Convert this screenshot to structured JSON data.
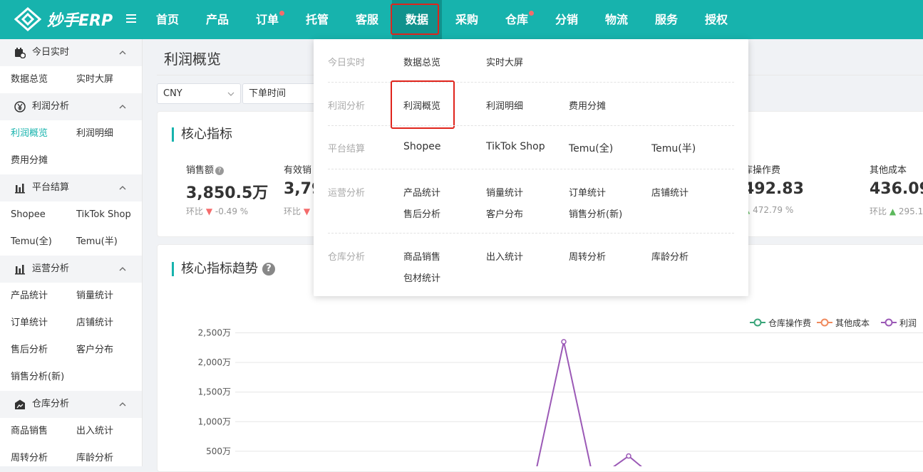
{
  "app": {
    "logo_text": "妙手ERP"
  },
  "topnav": {
    "items": [
      {
        "label": "首页"
      },
      {
        "label": "产品"
      },
      {
        "label": "订单",
        "dot": true
      },
      {
        "label": "托管"
      },
      {
        "label": "客服"
      },
      {
        "label": "数据",
        "active": true
      },
      {
        "label": "采购"
      },
      {
        "label": "仓库",
        "dot": true
      },
      {
        "label": "分销"
      },
      {
        "label": "物流"
      },
      {
        "label": "服务"
      },
      {
        "label": "授权"
      }
    ]
  },
  "sidebar": {
    "groups": [
      {
        "label": "今日实时",
        "icon": "calendar-clock-icon",
        "items": [
          "数据总览",
          "实时大屏"
        ]
      },
      {
        "label": "利润分析",
        "icon": "yen-circle-icon",
        "items": [
          "利润概览",
          "利润明细",
          "费用分摊"
        ]
      },
      {
        "label": "平台结算",
        "icon": "bar-chart-icon",
        "items": [
          "Shopee",
          "TikTok Shop",
          "Temu(全)",
          "Temu(半)"
        ]
      },
      {
        "label": "运营分析",
        "icon": "bar-chart-icon",
        "items": [
          "产品统计",
          "销量统计",
          "订单统计",
          "店铺统计",
          "售后分析",
          "客户分布",
          "销售分析(新)"
        ]
      },
      {
        "label": "仓库分析",
        "icon": "warehouse-icon",
        "items": [
          "商品销售",
          "出入统计",
          "周转分析",
          "库龄分析"
        ]
      }
    ],
    "active_item": "利润概览"
  },
  "page": {
    "title": "利润概览",
    "currency_select": "CNY",
    "time_select": "下单时间"
  },
  "core_metrics": {
    "title": "核心指标",
    "cmp_label": "环比",
    "metrics": [
      {
        "label": "销售额",
        "value": "3,850.5万",
        "change": "-0.49 %",
        "trend": "down"
      },
      {
        "label": "有效销",
        "value": "3,79",
        "trend": "down"
      },
      {
        "label": "库操作费",
        "value": "492.83",
        "change": "472.79 %",
        "trend": "up"
      },
      {
        "label": "其他成本",
        "value": "436.09",
        "change": "295.1",
        "trend": "up"
      }
    ]
  },
  "trend": {
    "title": "核心指标趋势",
    "legend": [
      {
        "name": "仓库操作费",
        "color": "#3aa57a"
      },
      {
        "name": "其他成本",
        "color": "#f08a5d"
      },
      {
        "name": "利润",
        "color": "#9b59b6"
      }
    ]
  },
  "chart_data": {
    "type": "line",
    "title": "核心指标趋势",
    "y_ticks": [
      "2,500万",
      "2,000万",
      "1,500万",
      "1,000万",
      "500万"
    ],
    "ylim": [
      0,
      2500
    ],
    "y_unit": "万",
    "grid": true,
    "legend_position": "top-right",
    "series": [
      {
        "name": "利润",
        "color": "#9b59b6",
        "points": [
          [
            0,
            0
          ],
          [
            1,
            2350
          ],
          [
            2,
            0
          ],
          [
            3,
            420
          ],
          [
            4,
            0
          ]
        ]
      }
    ]
  },
  "dropdown": {
    "rows": [
      {
        "category": "今日实时",
        "links": [
          "数据总览",
          "实时大屏"
        ]
      },
      {
        "category": "利润分析",
        "links": [
          "利润概览",
          "利润明细",
          "费用分摊"
        ]
      },
      {
        "category": "平台结算",
        "links": [
          "Shopee",
          "TikTok Shop",
          "Temu(全)",
          "Temu(半)"
        ]
      },
      {
        "category": "运营分析",
        "links": [
          "产品统计",
          "销量统计",
          "订单统计",
          "店铺统计",
          "售后分析",
          "客户分布",
          "销售分析(新)"
        ]
      },
      {
        "category": "仓库分析",
        "links": [
          "商品销售",
          "出入统计",
          "周转分析",
          "库龄分析",
          "包材统计"
        ]
      }
    ]
  }
}
